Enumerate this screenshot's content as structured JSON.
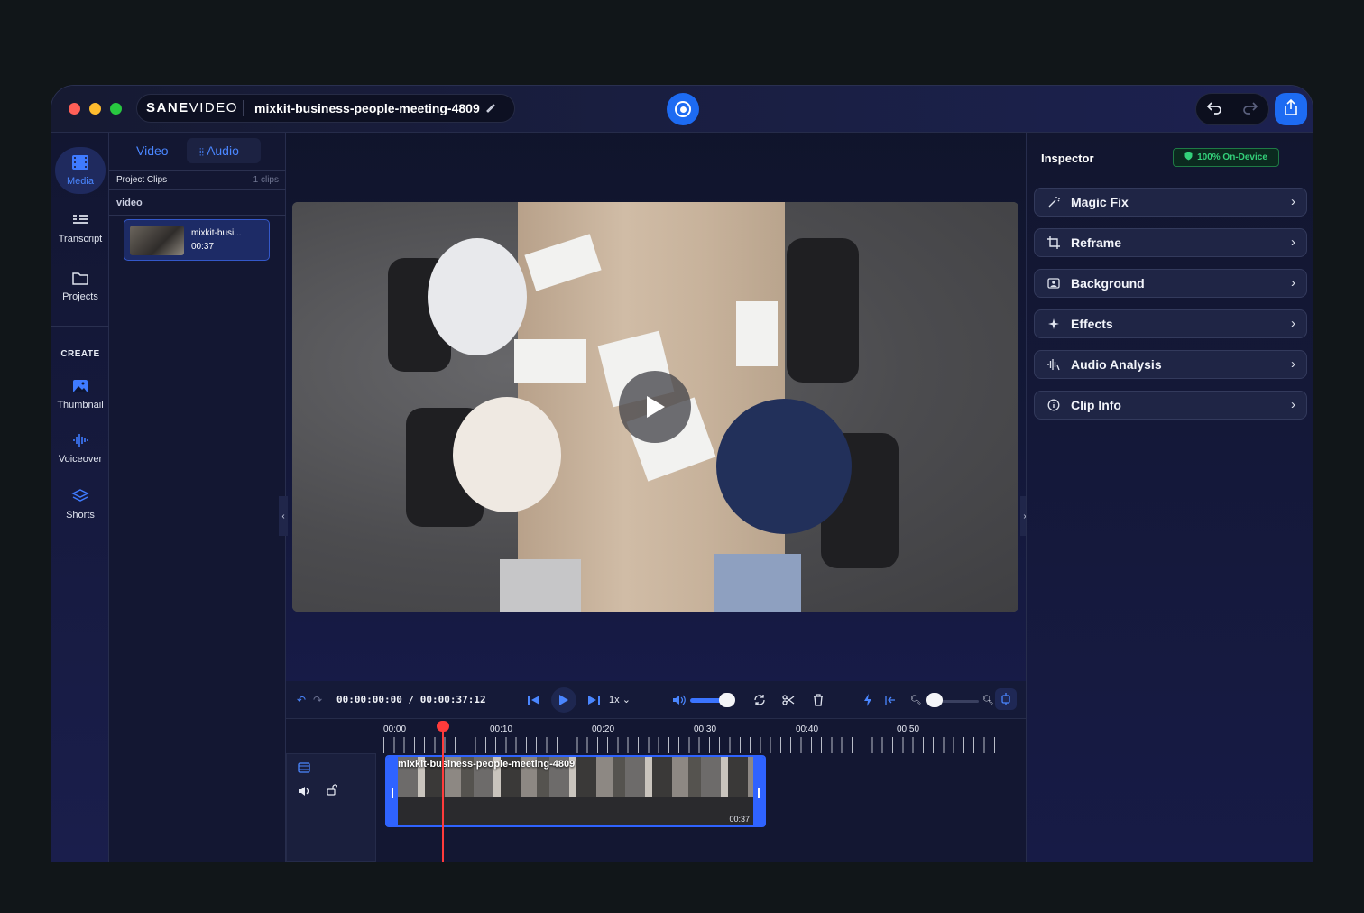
{
  "app": {
    "brand_bold": "SANE",
    "brand_light": "VIDEO",
    "project_title": "mixkit-business-people-meeting-4809"
  },
  "rail": {
    "items": [
      {
        "label": "Media",
        "icon": "film-icon",
        "active": true
      },
      {
        "label": "Transcript",
        "icon": "transcript-icon"
      },
      {
        "label": "Projects",
        "icon": "folder-icon"
      }
    ],
    "create_heading": "CREATE",
    "create_items": [
      {
        "label": "Thumbnail",
        "icon": "image-icon"
      },
      {
        "label": "Voiceover",
        "icon": "waveform-icon"
      },
      {
        "label": "Shorts",
        "icon": "layers-icon"
      }
    ]
  },
  "media": {
    "tabs": {
      "video": "Video",
      "audio": "Audio"
    },
    "project_clips_label": "Project Clips",
    "project_clips_count": "1 clips",
    "section": "video",
    "clip": {
      "name": "mixkit-busi...",
      "duration": "00:37"
    }
  },
  "inspector": {
    "title": "Inspector",
    "badge": "100% On-Device",
    "rows": [
      {
        "label": "Magic Fix",
        "icon": "magic-wand-icon"
      },
      {
        "label": "Reframe",
        "icon": "crop-icon"
      },
      {
        "label": "Background",
        "icon": "background-icon"
      },
      {
        "label": "Effects",
        "icon": "sparkle-icon"
      },
      {
        "label": "Audio Analysis",
        "icon": "audio-analysis-icon"
      },
      {
        "label": "Clip Info",
        "icon": "info-icon"
      }
    ]
  },
  "timeline": {
    "timecode": "00:00:00:00 / 00:00:37:12",
    "speed": "1x",
    "volume": 1.0,
    "zoom": 0.0,
    "ruler_labels": [
      "00:00",
      "00:10",
      "00:20",
      "00:30",
      "00:40",
      "00:50"
    ],
    "clip_label": "mixkit-business-people-meeting-4809",
    "clip_end": "00:37"
  },
  "colors": {
    "accent": "#1d6bf2",
    "playhead": "#ff3b3b",
    "badge_green": "#33d17a"
  }
}
